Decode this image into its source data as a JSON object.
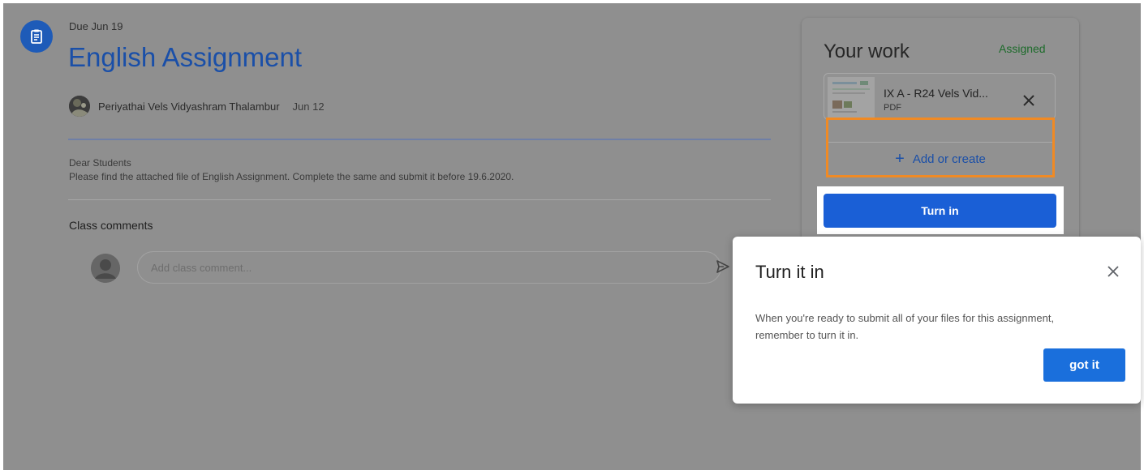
{
  "assignment": {
    "due": "Due Jun 19",
    "title": "English Assignment",
    "author": "Periyathai Vels Vidyashram Thalambur",
    "posted": "Jun 12",
    "description_line1": "Dear Students",
    "description_line2": "Please find the attached file of English Assignment. Complete the same and submit it before 19.6.2020."
  },
  "comments": {
    "heading": "Class comments",
    "placeholder": "Add class comment..."
  },
  "your_work": {
    "title": "Your work",
    "status": "Assigned",
    "attachment_name": "IX A - R24 Vels Vid...",
    "attachment_type": "PDF",
    "add_label": "Add or create",
    "turn_in_label": "Turn in"
  },
  "popover": {
    "title": "Turn it in",
    "body_line1": "When you're ready to submit all of your files for this assignment,",
    "body_line2": "remember to turn it in.",
    "button_label": "got it"
  },
  "colors": {
    "overlay_gray": "#8f8f8f",
    "title_blue": "#1a4fa8",
    "primary_button": "#1a5fd6",
    "status_green": "#1c6b2a",
    "highlight_orange": "#f08a24"
  },
  "icons": {
    "assignment": "assignment-icon",
    "send": "send-icon",
    "close": "close-icon",
    "add": "plus-icon"
  }
}
